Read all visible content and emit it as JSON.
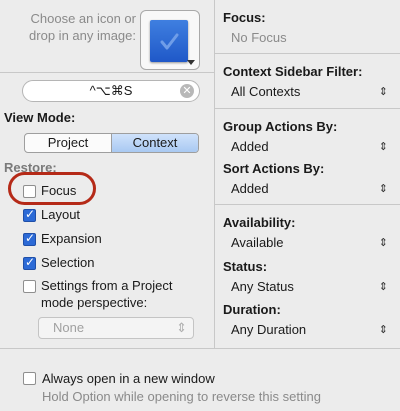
{
  "icon_area": {
    "prompt": "Choose an icon or drop in any image:"
  },
  "shortcut": {
    "value": "^⌥⌘S",
    "clear_glyph": "✕"
  },
  "view_mode": {
    "label": "View Mode:",
    "segments": [
      {
        "label": "Project",
        "selected": false
      },
      {
        "label": "Context",
        "selected": true
      }
    ]
  },
  "restore": {
    "label": "Restore:",
    "items": [
      {
        "label": "Focus",
        "checked": false
      },
      {
        "label": "Layout",
        "checked": true
      },
      {
        "label": "Expansion",
        "checked": true
      },
      {
        "label": "Selection",
        "checked": true
      },
      {
        "label": "Settings from a Project mode perspective:",
        "line1": "Settings from a Project",
        "line2": "mode perspective:",
        "checked": false
      }
    ],
    "perspective_popup": "None"
  },
  "right": {
    "focus_label": "Focus:",
    "focus_value": "No Focus",
    "context_filter_label": "Context Sidebar Filter:",
    "context_filter_value": "All Contexts",
    "group_label": "Group Actions By:",
    "group_value": "Added",
    "sort_label": "Sort Actions By:",
    "sort_value": "Added",
    "availability_label": "Availability:",
    "availability_value": "Available",
    "status_label": "Status:",
    "status_value": "Any Status",
    "duration_label": "Duration:",
    "duration_value": "Any Duration",
    "popup_arrows": "⇕"
  },
  "bottom": {
    "checkbox_label": "Always open in a new window",
    "checked": false,
    "hint": "Hold Option while opening to reverse this setting"
  },
  "colors": {
    "accent": "#2c6ad6",
    "highlight_ring": "#b52a18",
    "background": "#ececec"
  }
}
